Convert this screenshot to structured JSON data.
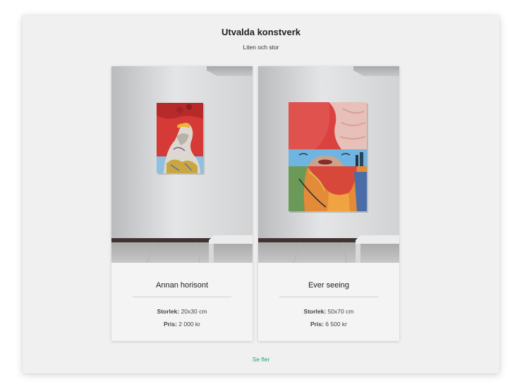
{
  "section": {
    "title": "Utvalda konstverk",
    "subtitle": "Liten och stor"
  },
  "artworks": [
    {
      "name": "Annan horisont",
      "size_label": "Storlek:",
      "size_value": "20x30 cm",
      "price_label": "Pris:",
      "price_value": "2 000 kr"
    },
    {
      "name": "Ever seeing",
      "size_label": "Storlek:",
      "size_value": "50x70 cm",
      "price_label": "Pris:",
      "price_value": "6 500 kr"
    }
  ],
  "more_link": "Se fler",
  "colors": {
    "link": "#1aa37a",
    "panel_bg": "#f0f0f0"
  }
}
